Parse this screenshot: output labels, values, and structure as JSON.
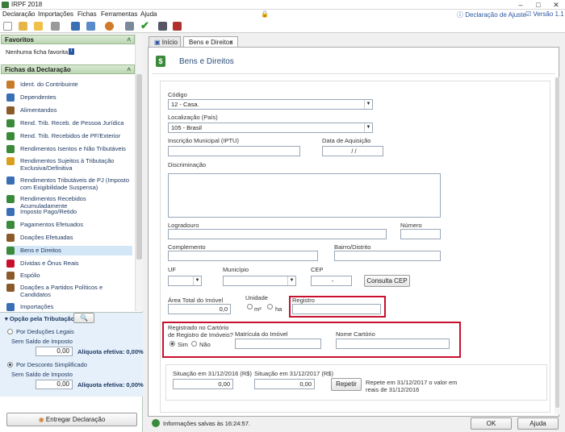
{
  "window": {
    "title": "IRPF 2018",
    "version": "Versão 1.1",
    "help_link": "Declaração de Ajuste"
  },
  "menu": [
    "Declaração",
    "Importações",
    "Fichas",
    "Ferramentas",
    "Ajuda"
  ],
  "favorites": {
    "title": "Favoritos",
    "empty_text": "Nenhuma ficha favorita"
  },
  "fichas": {
    "title": "Fichas da Declaração",
    "items": [
      {
        "label": "Ident. do Contribuinte",
        "color": "#c77a2a"
      },
      {
        "label": "Dependentes",
        "color": "#3b6fb5"
      },
      {
        "label": "Alimentandos",
        "color": "#8a5a2a"
      },
      {
        "label": "Rend. Trib. Receb. de Pessoa Jurídica",
        "color": "#3b8a3b"
      },
      {
        "label": "Rend. Trib. Recebidos de PF/Exterior",
        "color": "#3b8a3b"
      },
      {
        "label": "Rendimentos Isentos e Não Tributáveis",
        "color": "#3b8a3b"
      },
      {
        "label": "Rendimentos Sujeitos à Tributação Exclusiva/Definitiva",
        "color": "#d9a020"
      },
      {
        "label": "Rendimentos Tributáveis de PJ (Imposto com Exigibilidade Suspensa)",
        "color": "#3b6fb5"
      },
      {
        "label": "Rendimentos Recebidos Acumuladamente",
        "color": "#3b8a3b"
      },
      {
        "label": "Imposto Pago/Retido",
        "color": "#3b6fb5"
      },
      {
        "label": "Pagamentos Efetuados",
        "color": "#3b8a3b"
      },
      {
        "label": "Doações Efetuadas",
        "color": "#8a5a2a"
      },
      {
        "label": "Bens e Direitos",
        "color": "#3b8a3b"
      },
      {
        "label": "Dívidas e Ônus Reais",
        "color": "#c8102e"
      },
      {
        "label": "Espólio",
        "color": "#8a5a2a"
      },
      {
        "label": "Doações a Partidos Políticos e Candidatos",
        "color": "#8a5a2a"
      },
      {
        "label": "Importações",
        "color": "#3b6fb5"
      }
    ]
  },
  "options": {
    "title": "Opção pela Tributação:",
    "deducoes_label": "Por Deduções Legais",
    "saldo_label_1": "Sem Saldo de Imposto",
    "saldo_value_1": "0,00",
    "aliquota_1": "Alíquota efetiva: 0,00%",
    "simplificado_label": "Por Desconto Simplificado",
    "saldo_label_2": "Sem Saldo de Imposto",
    "saldo_value_2": "0,00",
    "aliquota_2": "Alíquota efetiva: 0,00%",
    "submit_label": "Entregar Declaração"
  },
  "tabs": [
    "Início",
    "Bens e Direitos"
  ],
  "page_title": "Bens e Direitos",
  "form": {
    "codigo_label": "Código",
    "codigo_value": "12 - Casa.",
    "localizacao_label": "Localização (País)",
    "localizacao_value": "105 - Brasil",
    "inscricao_label": "Inscrição Municipal (IPTU)",
    "data_label": "Data de Aquisição",
    "data_value": "/ /",
    "discriminacao_label": "Discriminação",
    "logradouro_label": "Logradouro",
    "numero_label": "Número",
    "complemento_label": "Complemento",
    "bairro_label": "Bairro/Distrito",
    "uf_label": "UF",
    "municipio_label": "Município",
    "cep_label": "CEP",
    "cep_value": "-",
    "consulta_cep_label": "Consulta CEP",
    "area_label": "Área Total do Imóvel",
    "area_value": "0,0",
    "unidade_label": "Unidade",
    "unit_m2": "m²",
    "unit_ha": "ha",
    "registro_label": "Registro",
    "cartorio_label_1": "Registrado no Cartório",
    "cartorio_label_2": "de Registro de Imóveis?",
    "sim_label": "Sim",
    "nao_label": "Não",
    "matricula_label": "Matrícula do Imóvel",
    "nome_cartorio_label": "Nome Cartório",
    "situacao_2016_label": "Situação em 31/12/2016 (R$)",
    "situacao_2016_value": "0,00",
    "situacao_2017_label": "Situação em 31/12/2017 (R$)",
    "situacao_2017_value": "0,00",
    "repetir_label": "Repetir",
    "repetir_hint": "Repete em 31/12/2017 o valor em reais de 31/12/2016"
  },
  "status": {
    "saved": "Informações salvas às 16:24:57.",
    "ok_label": "OK",
    "ajuda_label": "Ajuda"
  },
  "colors": {
    "highlight_red": "#c8102e",
    "header_green": "#bcd6b3",
    "link_blue": "#1f3a63"
  }
}
